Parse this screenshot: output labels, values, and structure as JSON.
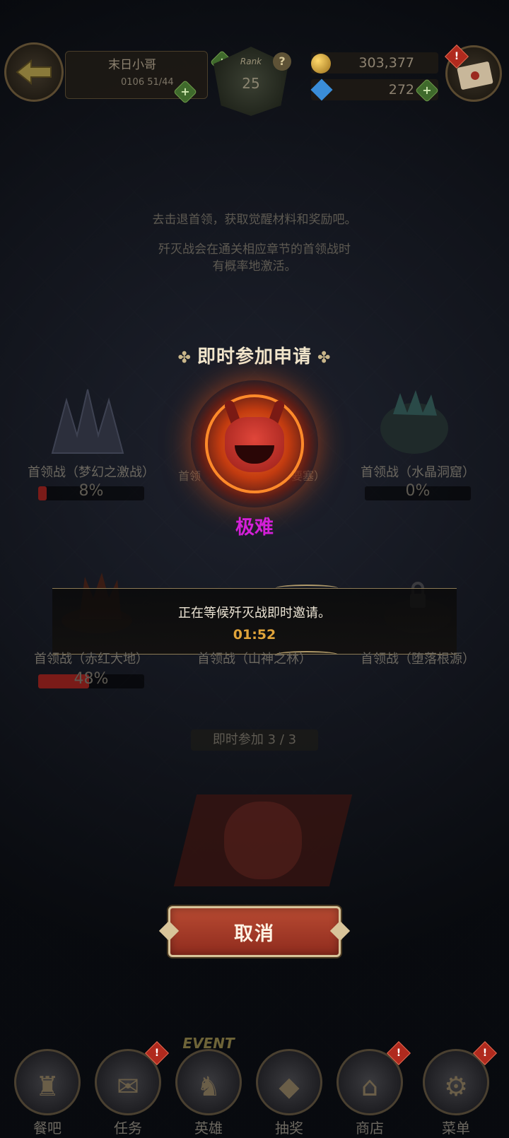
{
  "header": {
    "player_name": "末日小哥",
    "exp": "0106 51/44",
    "rank_label": "Rank",
    "rank_value": "25",
    "help_symbol": "?",
    "gold": "303,377",
    "gems": "272",
    "plus_symbol": "+",
    "alert_symbol": "!"
  },
  "hints": {
    "line1": "去击退首领，获取觉醒材料和奖励吧。",
    "line2": "歼灭战会在通关相应章节的首领战时",
    "line3": "有概率地激活。"
  },
  "section_title": "即时参加申请",
  "bosses": [
    {
      "name": "首领战（梦幻之激战）",
      "progress": "8%",
      "progress_value": 0.08
    },
    {
      "name": "首领战（水晶洞窟）",
      "progress": "0%",
      "progress_value": 0.0
    },
    {
      "name": "首领战（赤红大地）",
      "progress": "48%",
      "progress_value": 0.48
    },
    {
      "name": "首领战（山神之林）",
      "progress": "",
      "progress_value": 0
    },
    {
      "name": "首领战（堕落根源）",
      "progress": "",
      "progress_value": 0
    }
  ],
  "center_boss": {
    "difficulty": "极难",
    "partial_name_left": "首领",
    "partial_name_right": "要塞）"
  },
  "wait": {
    "message": "正在等候歼灭战即时邀请。",
    "timer": "01:52"
  },
  "entry_count": "即时参加 3 / 3",
  "cancel_label": "取消",
  "nav": [
    {
      "label": "餐吧",
      "icon": "wizard-hat-icon",
      "glyph": "♜",
      "alert": false
    },
    {
      "label": "任务",
      "icon": "scroll-icon",
      "glyph": "✉",
      "alert": true
    },
    {
      "label": "英雄",
      "icon": "armor-icon",
      "glyph": "♞",
      "alert": false,
      "tag": "EVENT"
    },
    {
      "label": "抽奖",
      "icon": "crystal-icon",
      "glyph": "◆",
      "alert": false
    },
    {
      "label": "商店",
      "icon": "shop-icon",
      "glyph": "⌂",
      "alert": true
    },
    {
      "label": "菜单",
      "icon": "gear-icon",
      "glyph": "⚙",
      "alert": true
    }
  ],
  "colors": {
    "difficulty": "#d41fd8",
    "timer": "#e0a43a",
    "cancel_button": "#a83c28"
  }
}
